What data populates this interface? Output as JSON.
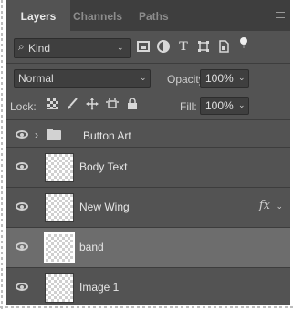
{
  "tabs": {
    "layers": "Layers",
    "channels": "Channels",
    "paths": "Paths"
  },
  "filter": {
    "search_glyph": "⌕",
    "kind_label": "Kind",
    "icons": [
      "image-filter-icon",
      "adjustment-filter-icon",
      "type-filter-icon",
      "shape-filter-icon",
      "smart-object-filter-icon",
      "filter-toggle-icon"
    ]
  },
  "blend": {
    "mode": "Normal",
    "opacity_label": "Opacity:",
    "opacity_value": "100%"
  },
  "lock": {
    "label": "Lock:",
    "icons": [
      "lock-transparent-pixels-icon",
      "lock-image-pixels-icon",
      "lock-position-icon",
      "lock-artboard-icon",
      "lock-all-icon"
    ],
    "fill_label": "Fill:",
    "fill_value": "100%"
  },
  "group": {
    "name": "Button Art"
  },
  "layers": [
    {
      "name": "Body Text"
    },
    {
      "name": "New Wing",
      "fx": "fx"
    },
    {
      "name": "band"
    },
    {
      "name": "Image 1"
    }
  ],
  "selected_layer": "band"
}
